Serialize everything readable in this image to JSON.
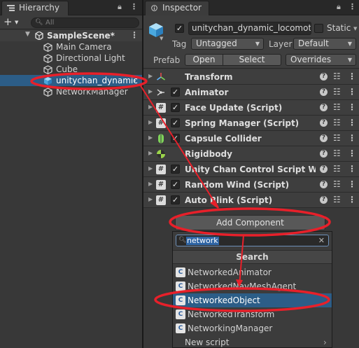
{
  "hierarchy": {
    "tab_title": "Hierarchy",
    "add_symbol": "+",
    "search_placeholder": "All",
    "scene_name": "SampleScene*",
    "items": [
      {
        "label": "Main Camera"
      },
      {
        "label": "Directional Light"
      },
      {
        "label": "Cube"
      },
      {
        "label": "unitychan_dynamic"
      },
      {
        "label": "NetworkManager"
      }
    ]
  },
  "inspector": {
    "tab_title": "Inspector",
    "object_name": "unitychan_dynamic_locomoti",
    "static_label": "Static",
    "tag_label": "Tag",
    "tag_value": "Untagged",
    "layer_label": "Layer",
    "layer_value": "Default",
    "prefab_label": "Prefab",
    "prefab_open": "Open",
    "prefab_select": "Select",
    "prefab_overrides": "Overrides",
    "components": [
      {
        "label": "Transform",
        "icon": "transform-icon",
        "has_checkbox": false
      },
      {
        "label": "Animator",
        "icon": "animator-icon",
        "has_checkbox": true
      },
      {
        "label": "Face Update (Script)",
        "icon": "script-icon",
        "has_checkbox": true
      },
      {
        "label": "Spring Manager (Script)",
        "icon": "script-icon",
        "has_checkbox": true
      },
      {
        "label": "Capsule Collider",
        "icon": "capsule-collider-icon",
        "has_checkbox": true
      },
      {
        "label": "Rigidbody",
        "icon": "rigidbody-icon",
        "has_checkbox": false
      },
      {
        "label": "Unity Chan Control Script With R",
        "icon": "script-icon",
        "has_checkbox": true
      },
      {
        "label": "Random Wind (Script)",
        "icon": "script-icon",
        "has_checkbox": true
      },
      {
        "label": "Auto Blink (Script)",
        "icon": "script-icon",
        "has_checkbox": true
      }
    ],
    "add_component_label": "Add Component"
  },
  "popup": {
    "search_text": "network",
    "header": "Search",
    "items": [
      {
        "label": "NetworkedAnimator"
      },
      {
        "label": "NetworkedNavMeshAgent"
      },
      {
        "label": "NetworkedObject"
      },
      {
        "label": "NetworkedTransform"
      },
      {
        "label": "NetworkingManager"
      },
      {
        "label": "New script"
      }
    ]
  },
  "colors": {
    "selection": "#2c5d87",
    "annotation": "#e8202a"
  }
}
